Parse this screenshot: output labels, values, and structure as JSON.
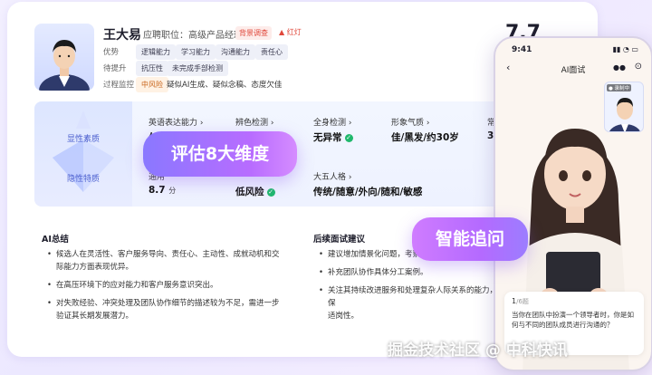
{
  "candidate": {
    "name": "王大易",
    "position": "应聘职位：高级产品经理",
    "bg_tag": "背景调查",
    "red_flag": "红灯",
    "score": "7.7"
  },
  "rows": {
    "strengths_label": "优势",
    "strengths": [
      "逻辑能力",
      "学习能力",
      "沟通能力",
      "责任心"
    ],
    "improve_label": "待提升",
    "improve": [
      "抗压性",
      "未完成手部检测"
    ],
    "monitor_label": "过程监控",
    "monitor_risk": "中风险",
    "monitor_text": "疑似AI生成、疑似念稿、态度欠佳"
  },
  "band": {
    "explicit_label": "显性素质",
    "implicit_label": "隐性特质",
    "dims": [
      {
        "title": "英语表达能力 ›",
        "value": "欠佳"
      },
      {
        "title": "辨色检测 ›",
        "value": "正常"
      },
      {
        "title": "全身检测 ›",
        "value": "无异常"
      },
      {
        "title": "形象气质 ›",
        "value": "佳/黑发/约30岁"
      },
      {
        "title": "常识",
        "value": "3/5"
      }
    ],
    "dims2": [
      {
        "title": "通用",
        "value": "8.7",
        "unit": "分"
      },
      {
        "title": "",
        "value": "低风险"
      },
      {
        "title": "大五人格 ›",
        "value": "传统/随意/外向/随和/敏感"
      }
    ]
  },
  "pills": {
    "dimension": "评估8大维度",
    "followup": "智能追问"
  },
  "summary": {
    "title": "AI总结",
    "items": [
      "候选人在灵活性、客户服务导向、责任心、主动性、成就动机和交际能力方面表现优异。",
      "在高压环境下的应对能力和客户服务意识突出。",
      "对失败经验、冲突处理及团队协作细节的描述较为不足，需进一步验证其长期发展潜力。"
    ]
  },
  "advice": {
    "title": "后续面试建议",
    "items": [
      "建议增加情景化问题，考察候",
      "补充团队协作具体分工案例。",
      "关注其持续改进服务和处理复杂人际关系的能力，确保",
      "适岗性。"
    ]
  },
  "phone": {
    "time": "9:41",
    "title": "AI面试",
    "recording": "● 录制中",
    "q_index": "1",
    "q_total": "/6题",
    "question": "当你在团队中扮演一个领导者时，你是如何与不同的团队成员进行沟通的？"
  },
  "watermark": "掘金技术社区 @ 中科快讯"
}
